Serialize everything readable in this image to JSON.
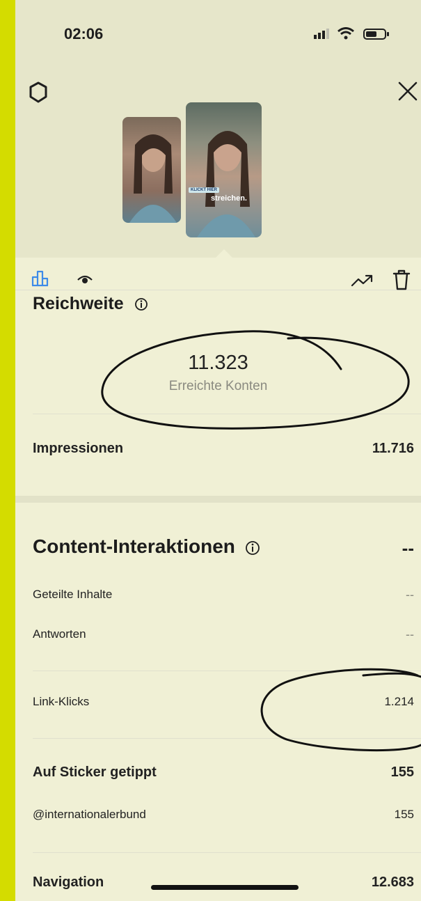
{
  "status_bar": {
    "time": "02:06"
  },
  "header": {
    "settings_icon": "settings-icon",
    "close_icon": "close-icon"
  },
  "stories": [
    {
      "kind": "thumbnail"
    },
    {
      "kind": "thumbnail",
      "tag": "KLICKT HIER",
      "caption": "streichen."
    }
  ],
  "tabs": [
    {
      "icon": "bar-chart-icon",
      "active": true
    },
    {
      "icon": "eye-icon",
      "active": false
    }
  ],
  "actions": [
    {
      "icon": "trending-up-icon"
    },
    {
      "icon": "trash-icon"
    }
  ],
  "reach": {
    "title": "Reichweite",
    "value": "11.323",
    "label": "Erreichte Konten"
  },
  "impressions": {
    "label": "Impressionen",
    "value": "11.716"
  },
  "content_interactions": {
    "title": "Content-Interaktionen",
    "value": "--",
    "rows": [
      {
        "label": "Geteilte Inhalte",
        "value": "--"
      },
      {
        "label": "Antworten",
        "value": "--"
      }
    ]
  },
  "link_clicks": {
    "label": "Link-Klicks",
    "value": "1.214"
  },
  "sticker": {
    "label": "Auf Sticker getippt",
    "value": "155",
    "account": "@internationalerbund",
    "account_value": "155"
  },
  "navigation": {
    "label": "Navigation",
    "value": "12.683"
  },
  "colors": {
    "background_accent": "#d4dc00",
    "screen": "#f0f0d5",
    "active_tab": "#3d8be8"
  }
}
